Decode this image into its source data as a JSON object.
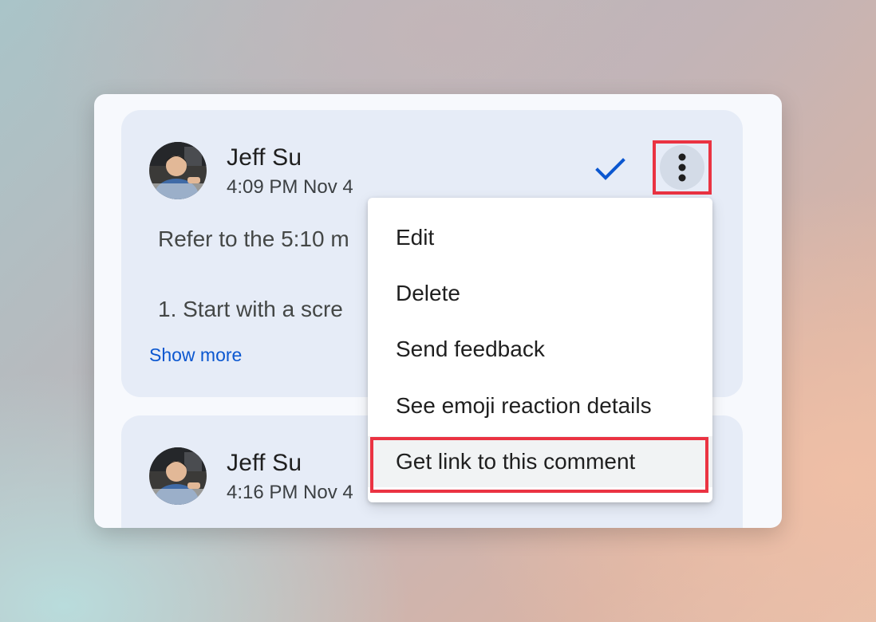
{
  "comments": [
    {
      "author": "Jeff Su",
      "timestamp": "4:09 PM Nov 4",
      "body_line1": "Refer to the 5:10 m",
      "body_line2": "1. Start with a scre",
      "show_more_label": "Show more",
      "resolve_icon": "checkmark-icon",
      "more_icon": "more-vertical-icon"
    },
    {
      "author": "Jeff Su",
      "timestamp": "4:16 PM Nov 4"
    }
  ],
  "menu": {
    "items": [
      {
        "label": "Edit"
      },
      {
        "label": "Delete"
      },
      {
        "label": "Send feedback"
      },
      {
        "label": "See emoji reaction details"
      },
      {
        "label": "Get link to this comment",
        "highlighted": true
      }
    ]
  },
  "colors": {
    "accent": "#0b57d0",
    "annotation_red": "#ea3342",
    "card_bg": "#e6ecf7",
    "panel_bg": "#f7f9fd"
  }
}
